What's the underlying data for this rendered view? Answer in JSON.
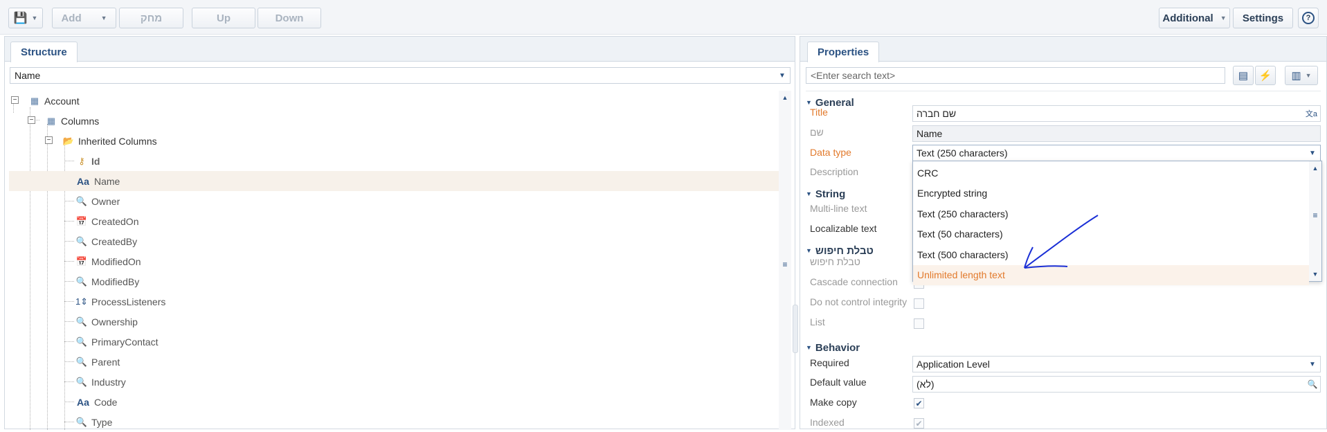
{
  "toolbar": {
    "add_label": "Add",
    "delete_label": "מחק",
    "up_label": "Up",
    "down_label": "Down",
    "additional_label": "Additional",
    "settings_label": "Settings",
    "help_glyph": "?"
  },
  "structure": {
    "tab_label": "Structure",
    "filter_value": "Name",
    "tree": {
      "root": "Account",
      "columns": "Columns",
      "inherited": "Inherited Columns",
      "items": [
        {
          "label": "Id",
          "icon": "key-icon",
          "glyph": "⚷",
          "color": "#c9912a",
          "bold": true
        },
        {
          "label": "Name",
          "icon": "text-type-icon",
          "glyph": "Aa",
          "color": "#2b5283",
          "selected": true
        },
        {
          "label": "Owner",
          "icon": "lookup-icon",
          "glyph": "🔍",
          "color": "#2b5283"
        },
        {
          "label": "CreatedOn",
          "icon": "datetime-icon",
          "glyph": "📅",
          "color": "#2b5283"
        },
        {
          "label": "CreatedBy",
          "icon": "lookup-icon",
          "glyph": "🔍",
          "color": "#2b5283"
        },
        {
          "label": "ModifiedOn",
          "icon": "datetime-icon",
          "glyph": "📅",
          "color": "#2b5283"
        },
        {
          "label": "ModifiedBy",
          "icon": "lookup-icon",
          "glyph": "🔍",
          "color": "#2b5283"
        },
        {
          "label": "ProcessListeners",
          "icon": "integer-icon",
          "glyph": "1⇕",
          "color": "#2b5283"
        },
        {
          "label": "Ownership",
          "icon": "lookup-icon",
          "glyph": "🔍",
          "color": "#2b5283"
        },
        {
          "label": "PrimaryContact",
          "icon": "lookup-icon",
          "glyph": "🔍",
          "color": "#2b5283"
        },
        {
          "label": "Parent",
          "icon": "lookup-icon",
          "glyph": "🔍",
          "color": "#2b5283"
        },
        {
          "label": "Industry",
          "icon": "lookup-icon",
          "glyph": "🔍",
          "color": "#2b5283"
        },
        {
          "label": "Code",
          "icon": "text-type-icon",
          "glyph": "Aa",
          "color": "#2b5283"
        },
        {
          "label": "Type",
          "icon": "lookup-icon",
          "glyph": "🔍",
          "color": "#2b5283"
        }
      ]
    }
  },
  "properties": {
    "tab_label": "Properties",
    "search_placeholder": "<Enter search text>",
    "sections": {
      "general": "General",
      "string": "String",
      "lookup": "טבלת חיפוש",
      "behavior": "Behavior"
    },
    "labels": {
      "title": "Title",
      "code": "שם",
      "data_type": "Data type",
      "description": "Description",
      "multiline": "Multi-line text",
      "localizable": "Localizable text",
      "lookup": "טבלת חיפוש",
      "cascade": "Cascade connection",
      "no_integrity": "Do not control integrity",
      "list": "List",
      "required": "Required",
      "default_value": "Default value",
      "make_copy": "Make copy",
      "indexed": "Indexed"
    },
    "values": {
      "title": "שם חברה",
      "code": "Name",
      "data_type": "Text (250 characters)",
      "required": "Application Level",
      "default_value": "(לא)"
    },
    "dropdown_options": [
      "CRC",
      "Encrypted string",
      "Text (250 characters)",
      "Text (50 characters)",
      "Text (500 characters)",
      "Unlimited length text"
    ],
    "highlighted_option": "Unlimited length text"
  },
  "colors": {
    "accent": "#2b5283",
    "highlight": "#e27a2c",
    "annotation": "#1a2fd6"
  }
}
